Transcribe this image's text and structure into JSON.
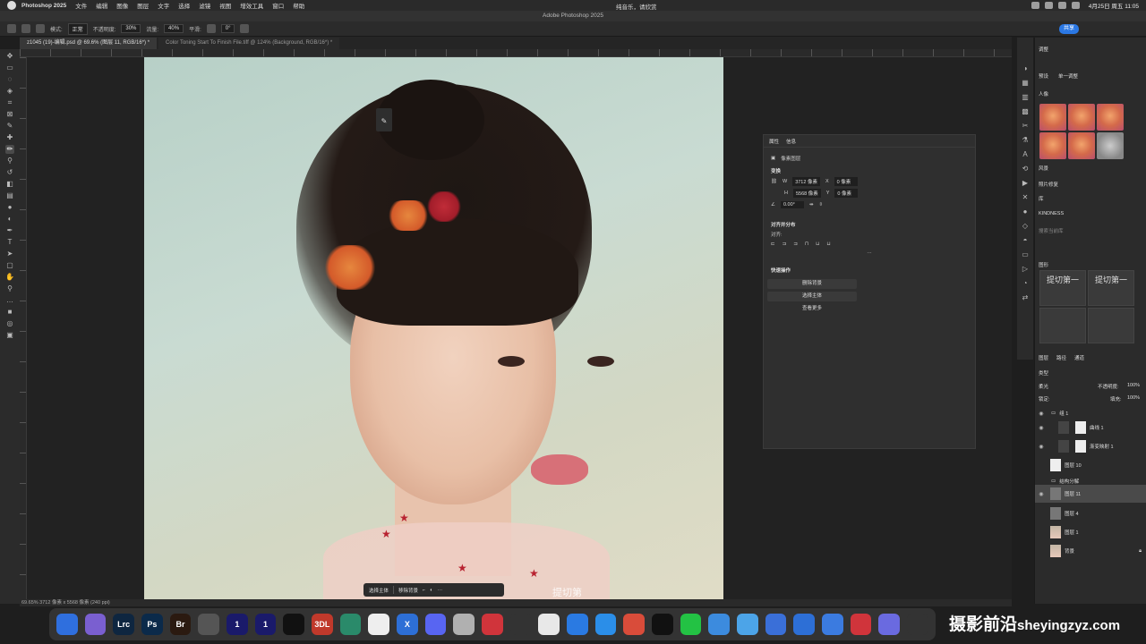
{
  "menubar": {
    "app": "Photoshop 2025",
    "items": [
      "文件",
      "编辑",
      "图像",
      "图层",
      "文字",
      "选择",
      "滤镜",
      "视图",
      "增效工具",
      "窗口",
      "帮助"
    ],
    "status_text": "纯音乐，请欣赏",
    "clock": "4月25日 周五 11:05"
  },
  "window": {
    "title": "Adobe Photoshop 2025"
  },
  "options": {
    "mode_label": "模式:",
    "mode_value": "正常",
    "opacity_label": "不透明度:",
    "opacity_value": "30%",
    "flow_label": "流量:",
    "flow_value": "40%",
    "smooth_label": "平滑:",
    "angle_value": "0°",
    "share_label": "共享"
  },
  "tabs": [
    {
      "label": "z1045 (19)-编辑.psd @ 69.6% (图层 11, RGB/16*) *"
    },
    {
      "label": "Color Toning Start To Finish File.tiff @ 124% (Background, RGB/16*) *"
    }
  ],
  "canvas": {
    "watermark": "提切第"
  },
  "context_bar": {
    "select_subject": "选择主体",
    "remove_bg": "移除背景",
    "more": "···"
  },
  "properties": {
    "tab1": "属性",
    "tab2": "信息",
    "pixel_layer": "像素图层",
    "transform": "变换",
    "w_label": "W",
    "w_value": "3712 像素",
    "x_label": "X",
    "x_value": "0 像素",
    "h_label": "H",
    "h_value": "5568 像素",
    "y_label": "Y",
    "y_value": "0 像素",
    "angle": "0.00°",
    "align": "对齐并分布",
    "align_sub": "对齐:",
    "align_more": "···",
    "quick_actions": "快速操作",
    "remove_bg_btn": "删除背景",
    "select_subject_btn": "选择主体",
    "more_btn": "查看更多"
  },
  "right_panel": {
    "adjustments": "调整",
    "presets_tab": "预设",
    "single_tab": "单一调整",
    "portrait": "人像",
    "landscape": "风景",
    "photo_repair": "照片修复",
    "library": "库",
    "library_name": "KINDNESS",
    "library_search": "搜索当前库",
    "graphics": "图形",
    "tile_text": "提切第一",
    "layers_tabs": [
      "图层",
      "路径",
      "通道"
    ],
    "kind_label": "类型",
    "blend_mode": "柔光",
    "opacity_label": "不透明度:",
    "opacity_value": "100%",
    "fill_label": "填充:",
    "fill_value": "100%",
    "lock_label": "锁定:",
    "layers": [
      {
        "name": "组 1",
        "type": "group"
      },
      {
        "name": "曲线 1",
        "type": "adj"
      },
      {
        "name": "渐变映射 1",
        "type": "adj"
      },
      {
        "name": "图层 10",
        "type": "white"
      },
      {
        "name": "结构分解",
        "type": "group"
      },
      {
        "name": "图层 11",
        "type": "gray",
        "selected": true
      },
      {
        "name": "图层 4",
        "type": "gray"
      },
      {
        "name": "图层 1",
        "type": "photo"
      },
      {
        "name": "背景",
        "type": "photo"
      }
    ]
  },
  "statusbar": {
    "text": "69.65%   3712 像素 x 5568 像素 (240 ppi)"
  },
  "dock": {
    "apps": [
      {
        "label": "",
        "color": "#2f6fde",
        "icon": "finder-icon"
      },
      {
        "label": "",
        "color": "#7a5fd0",
        "icon": "launchpad-icon"
      },
      {
        "label": "Lrc",
        "color": "#0e2640",
        "icon": "lightroom-icon"
      },
      {
        "label": "Ps",
        "color": "#0b2a4a",
        "icon": "photoshop-icon"
      },
      {
        "label": "Br",
        "color": "#2b1a10",
        "icon": "bridge-icon"
      },
      {
        "label": "",
        "color": "#555",
        "icon": "window-icon"
      },
      {
        "label": "1",
        "color": "#1a1a6a",
        "icon": "onepassword-icon"
      },
      {
        "label": "1",
        "color": "#1a1a6a",
        "icon": "onepassword-icon-2"
      },
      {
        "label": "",
        "color": "#111",
        "icon": "capcut-icon"
      },
      {
        "label": "3DL",
        "color": "#c0392b",
        "icon": "3dl-icon"
      },
      {
        "label": "",
        "color": "#2a8a6a",
        "icon": "app-icon"
      },
      {
        "label": "",
        "color": "#eee",
        "icon": "vectorworks-icon"
      },
      {
        "label": "X",
        "color": "#2d6fd6",
        "icon": "x-icon"
      },
      {
        "label": "",
        "color": "#5865f2",
        "icon": "discord-icon"
      },
      {
        "label": "",
        "color": "#b0b0b0",
        "icon": "settings-icon"
      },
      {
        "label": "",
        "color": "#d0343b",
        "icon": "netease-icon"
      },
      {
        "label": "",
        "color": "#333",
        "icon": "safari-icon"
      },
      {
        "label": "",
        "color": "#e8e8e8",
        "icon": "chrome-icon"
      },
      {
        "label": "",
        "color": "#2a7ae2",
        "icon": "app2-icon"
      },
      {
        "label": "",
        "color": "#2b8ee8",
        "icon": "edge-icon"
      },
      {
        "label": "",
        "color": "#d94c3a",
        "icon": "app3-icon"
      },
      {
        "label": "",
        "color": "#111",
        "icon": "qq-icon"
      },
      {
        "label": "",
        "color": "#23c244",
        "icon": "wechat-icon"
      },
      {
        "label": "",
        "color": "#3c8bde",
        "icon": "app4-icon"
      },
      {
        "label": "",
        "color": "#4ca4e8",
        "icon": "app5-icon"
      },
      {
        "label": "",
        "color": "#3a6fd8",
        "icon": "app6-icon"
      },
      {
        "label": "",
        "color": "#2d6fd6",
        "icon": "app7-icon"
      },
      {
        "label": "",
        "color": "#3b7be0",
        "icon": "app8-icon"
      },
      {
        "label": "",
        "color": "#d0343b",
        "icon": "music-icon"
      },
      {
        "label": "",
        "color": "#6a6ae0",
        "icon": "app9-icon"
      },
      {
        "label": "",
        "color": "#333",
        "icon": "app10-icon"
      }
    ]
  },
  "brand": {
    "zh": "摄影前沿",
    "en": "sheyingzyz.com"
  }
}
